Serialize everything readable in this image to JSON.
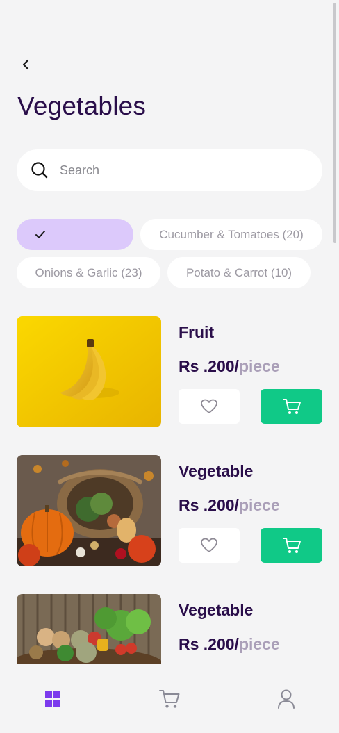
{
  "header": {
    "title": "Vegetables"
  },
  "search": {
    "placeholder": "Search"
  },
  "filters": [
    {
      "label": "",
      "selected": true
    },
    {
      "label": "Cucumber & Tomatoes (20)",
      "selected": false
    },
    {
      "label": "Onions & Garlic (23)",
      "selected": false
    },
    {
      "label": "Potato & Carrot (10)",
      "selected": false
    }
  ],
  "products": [
    {
      "name": "Fruit",
      "price": "Rs .200/",
      "unit": "piece",
      "image": "banana"
    },
    {
      "name": "Vegetable",
      "price": "Rs .200/",
      "unit": "piece",
      "image": "pumpkin-basket"
    },
    {
      "name": "Vegetable",
      "price": "Rs .200/",
      "unit": "piece",
      "image": "vegetable-basket"
    }
  ],
  "bottom_nav": [
    {
      "icon": "grid-icon",
      "active": true
    },
    {
      "icon": "cart-icon",
      "active": false
    },
    {
      "icon": "user-icon",
      "active": false
    }
  ],
  "colors": {
    "title": "#2a0e4a",
    "accent": "#7c3aed",
    "chip_selected": "#dcc9fb",
    "cart_button": "#10c987",
    "price_unit": "#aa9fb8"
  }
}
